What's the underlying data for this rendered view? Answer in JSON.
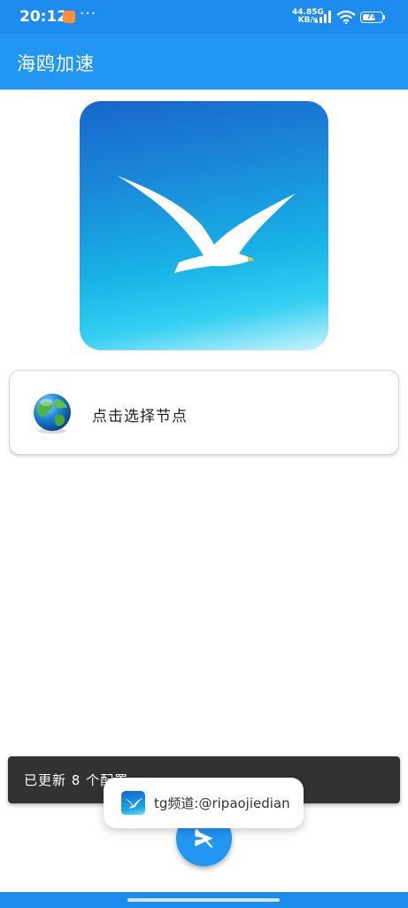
{
  "status_bar": {
    "time": "20:12",
    "dots": "···",
    "net_speed_value": "44.8",
    "net_speed_unit": "KB/s",
    "network_type": "5G",
    "battery": "74",
    "icons": [
      "notification-app-icon",
      "signal-icon",
      "wifi-icon",
      "battery-icon"
    ]
  },
  "app_bar": {
    "title": "海鸥加速"
  },
  "hero": {
    "icon": "seagull-logo"
  },
  "node_card": {
    "label": "点击选择节点",
    "icon": "globe-icon"
  },
  "snackbar": {
    "message": "已更新 8 个配置"
  },
  "toast": {
    "text": "tg频道:@ripaojiedian",
    "icon": "seagull-app-icon"
  },
  "fab": {
    "icon": "paper-plane-off-icon"
  },
  "colors": {
    "primary": "#2196f3",
    "status_bar": "#1e8bef",
    "snackbar": "#323232"
  }
}
